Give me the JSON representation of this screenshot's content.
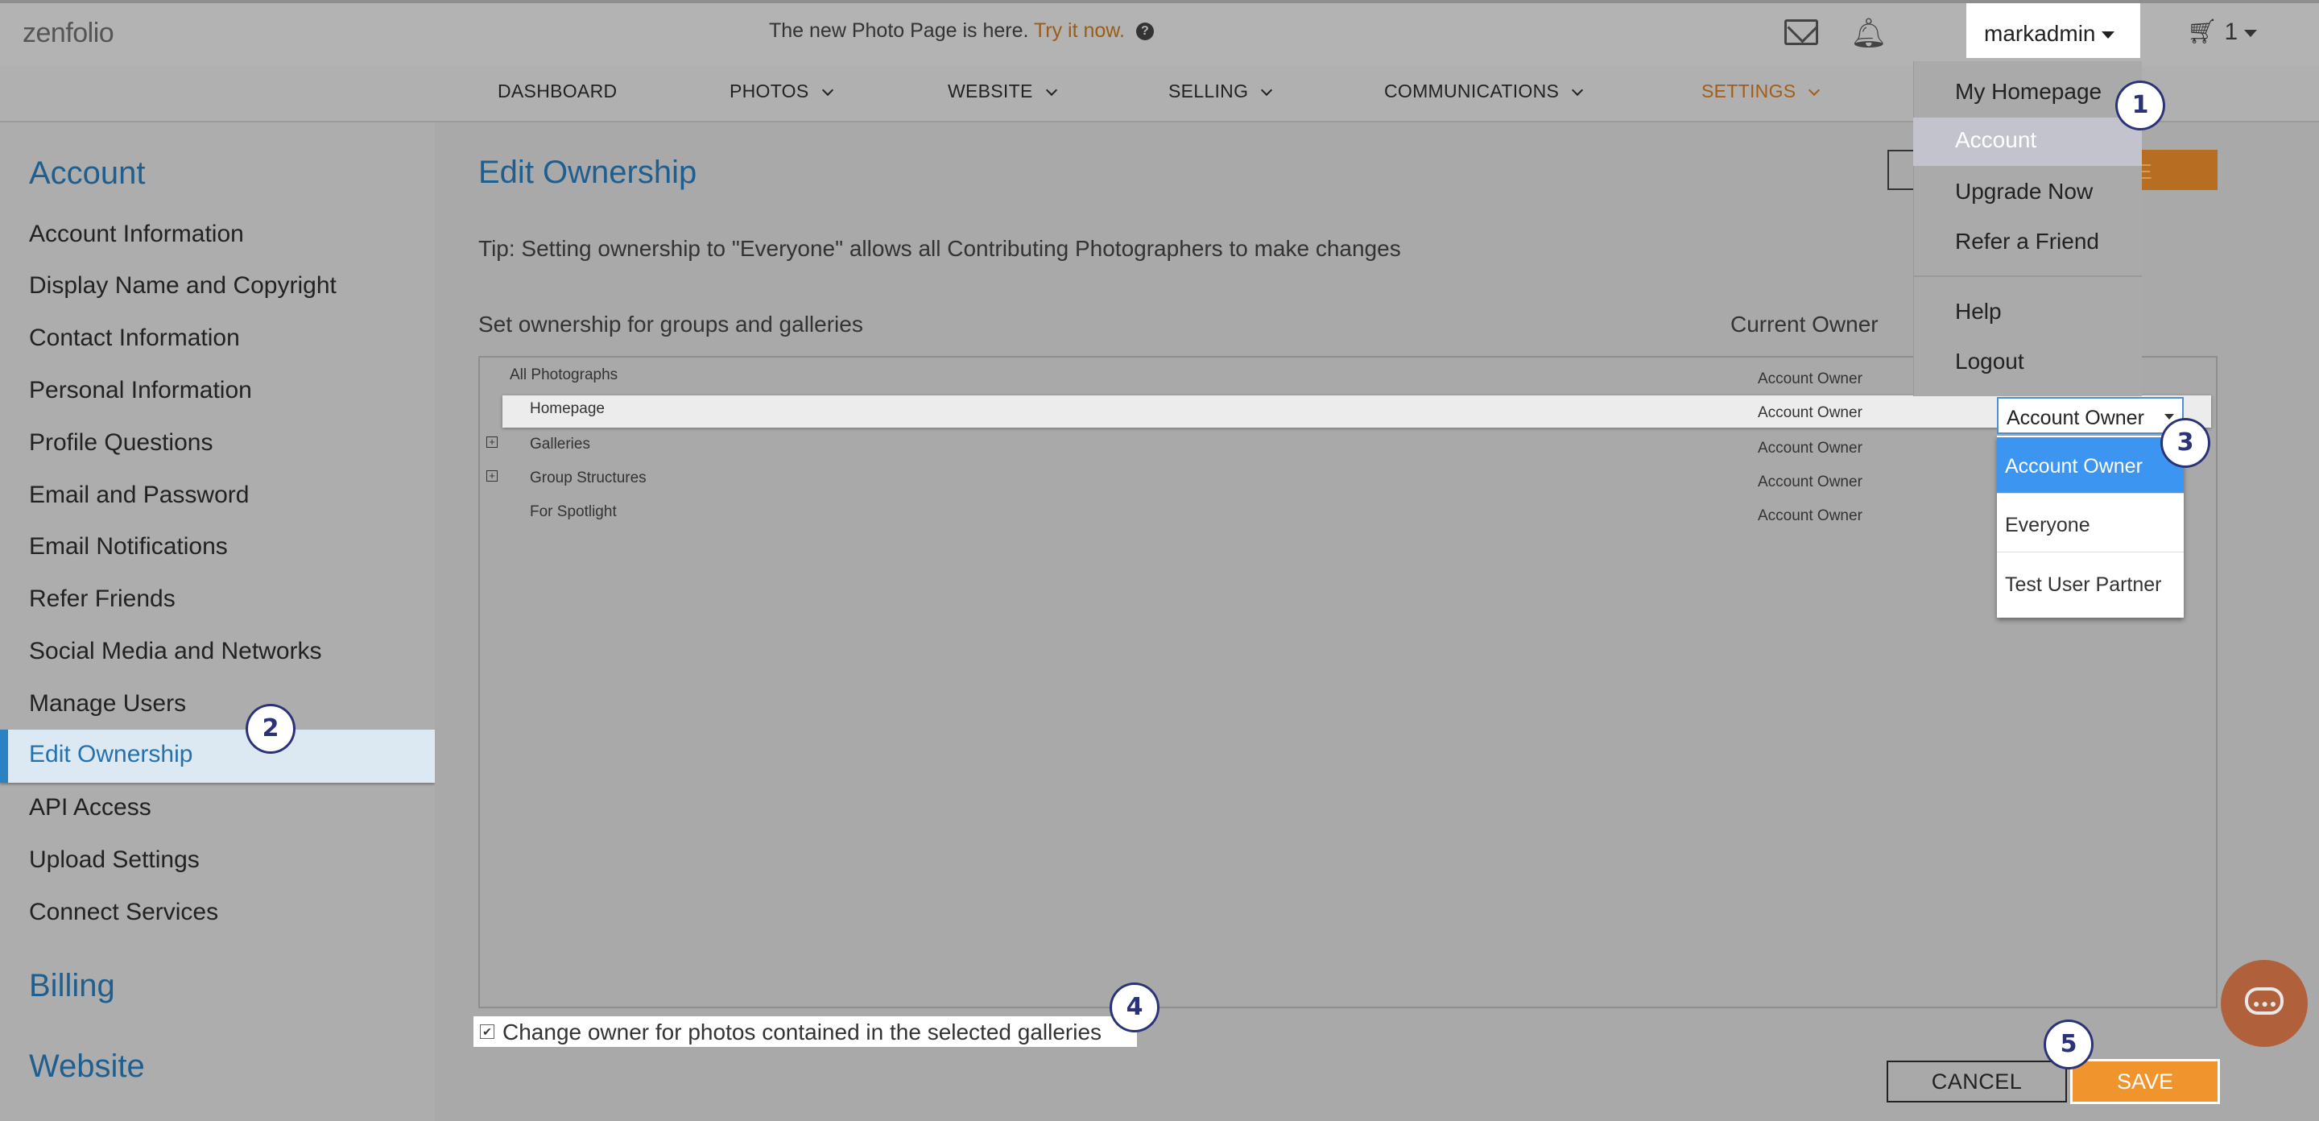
{
  "app": {
    "logo": "zenfolio"
  },
  "topbar": {
    "promo_text": "The new Photo Page is here.",
    "promo_link": "Try it now.",
    "help": "?",
    "username": "markadmin",
    "cart_count": "1"
  },
  "nav": {
    "items": [
      {
        "label": "DASHBOARD"
      },
      {
        "label": "PHOTOS"
      },
      {
        "label": "WEBSITE"
      },
      {
        "label": "SELLING"
      },
      {
        "label": "COMMUNICATIONS"
      },
      {
        "label": "SETTINGS"
      }
    ]
  },
  "user_menu": {
    "items": [
      {
        "label": "My Homepage"
      },
      {
        "label": "Account"
      },
      {
        "label": "Upgrade Now"
      },
      {
        "label": "Refer a Friend"
      },
      {
        "label": "Help"
      },
      {
        "label": "Logout"
      }
    ],
    "selected": "Account"
  },
  "sidebar": {
    "sections": {
      "account": "Account",
      "billing": "Billing",
      "website": "Website"
    },
    "items": [
      {
        "label": "Account Information"
      },
      {
        "label": "Display Name and Copyright"
      },
      {
        "label": "Contact Information"
      },
      {
        "label": "Personal Information"
      },
      {
        "label": "Profile Questions"
      },
      {
        "label": "Email and Password"
      },
      {
        "label": "Email Notifications"
      },
      {
        "label": "Refer Friends"
      },
      {
        "label": "Social Media and Networks"
      },
      {
        "label": "Manage Users"
      },
      {
        "label": "Edit Ownership"
      },
      {
        "label": "API Access"
      },
      {
        "label": "Upload Settings"
      },
      {
        "label": "Connect Services"
      }
    ],
    "active": "Edit Ownership"
  },
  "main": {
    "title": "Edit Ownership",
    "tip": "Tip: Setting ownership to \"Everyone\" allows all Contributing Photographers to make changes",
    "set_label": "Set ownership for groups and galleries",
    "owner_header": "Current Owner",
    "top_save_partial": "VE",
    "tree": [
      {
        "name": "All Photographs",
        "owner": "Account Owner"
      },
      {
        "name": "Homepage",
        "owner": "Account Owner"
      },
      {
        "name": "Galleries",
        "owner": "Account Owner"
      },
      {
        "name": "Group Structures",
        "owner": "Account Owner"
      },
      {
        "name": "For Spotlight",
        "owner": "Account Owner"
      }
    ],
    "owner_select": {
      "value": "Account Owner",
      "options": [
        "Account Owner",
        "Everyone",
        "Test User Partner"
      ]
    },
    "checkbox_label": "Change owner for photos contained in the selected galleries",
    "checkbox_checked": "✔",
    "cancel_label": "CANCEL",
    "save_label": "SAVE"
  },
  "steps": [
    "1",
    "2",
    "3",
    "4",
    "5"
  ],
  "colors": {
    "accent": "#1f5f8f",
    "save": "#f0952e",
    "option_selected": "#3d95f2",
    "step_ring": "#2a3278"
  }
}
